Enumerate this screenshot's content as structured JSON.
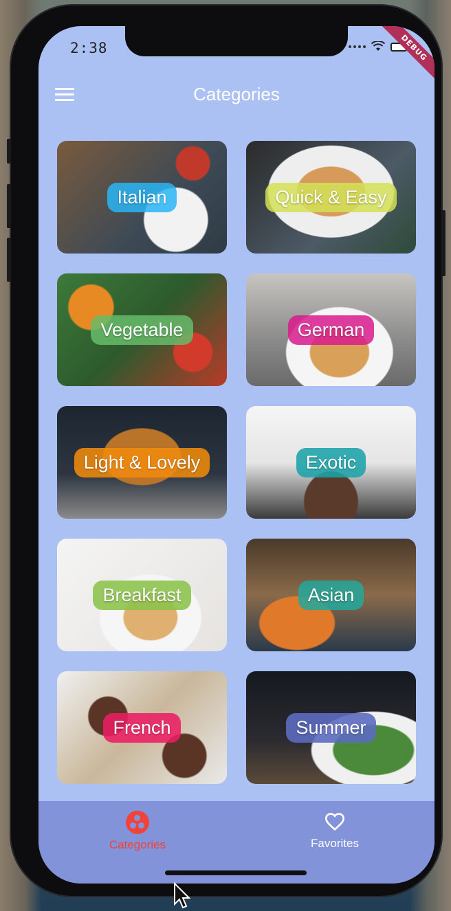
{
  "status_bar": {
    "time": "2:38",
    "debug_label": "DEBUG"
  },
  "app_bar": {
    "title": "Categories",
    "menu_icon": "hamburger-menu-icon"
  },
  "categories": [
    {
      "label": "Italian",
      "color": "#29b6f6"
    },
    {
      "label": "Quick & Easy",
      "color": "#d4e157"
    },
    {
      "label": "Vegetable",
      "color": "#66bb6a"
    },
    {
      "label": "German",
      "color": "#d81b8c"
    },
    {
      "label": "Light & Lovely",
      "color": "#f08a0c"
    },
    {
      "label": "Exotic",
      "color": "#1aa3a8"
    },
    {
      "label": "Breakfast",
      "color": "#8bc34a"
    },
    {
      "label": "Asian",
      "color": "#26a69a"
    },
    {
      "label": "French",
      "color": "#e91e63"
    },
    {
      "label": "Summer",
      "color": "#5c6bc0"
    }
  ],
  "bottom_nav": {
    "items": [
      {
        "label": "Categories",
        "icon": "category-icon",
        "active": true
      },
      {
        "label": "Favorites",
        "icon": "heart-icon",
        "active": false
      }
    ],
    "active_color": "#f0433a"
  },
  "colors": {
    "screen_background": "#abc0f3",
    "nav_background": "#8293d9"
  }
}
